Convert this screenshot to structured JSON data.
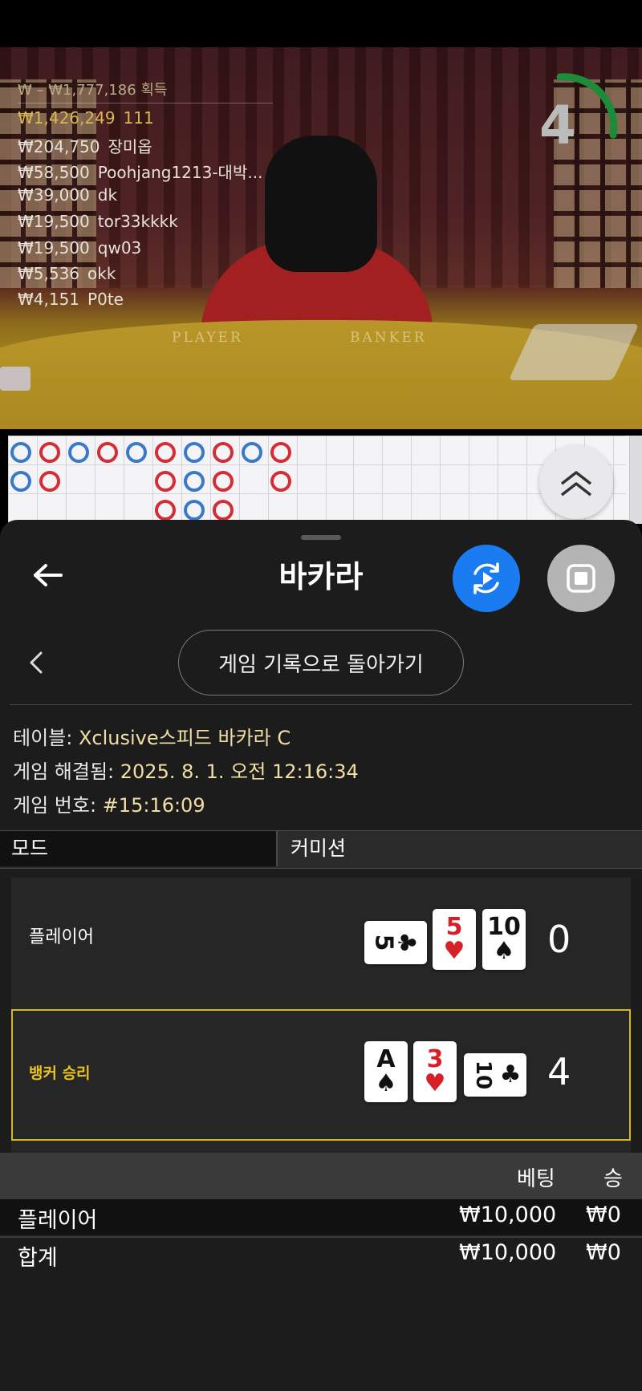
{
  "leaderboard": {
    "header": "₩ – ₩1,777,186 획득",
    "rows": [
      {
        "amount": "₩1,426,249",
        "name": "111"
      },
      {
        "amount": "₩204,750",
        "name": "장미옵"
      },
      {
        "amount": "₩58,500",
        "name": "Poohjang1213-대박..."
      },
      {
        "amount": "₩39,000",
        "name": "dk"
      },
      {
        "amount": "₩19,500",
        "name": "tor33kkkk"
      },
      {
        "amount": "₩19,500",
        "name": "qw03"
      },
      {
        "amount": "₩5,536",
        "name": "okk"
      },
      {
        "amount": "₩4,151",
        "name": "P0te"
      }
    ]
  },
  "video": {
    "table_labels": [
      "PLAYER",
      "BANKER"
    ],
    "timer": "4"
  },
  "sheet": {
    "title": "바카라",
    "history_button": "게임 기록으로 돌아가기",
    "info": {
      "table_label": "테이블:",
      "table_value": "Xclusive스피드 바카라 C",
      "resolved_label": "게임 해결됨:",
      "resolved_value": "2025. 8. 1. 오전 12:16:34",
      "number_label": "게임 번호:",
      "number_value": "#15:16:09"
    },
    "mode_label": "모드",
    "mode_value": "커미션"
  },
  "hands": {
    "player": {
      "label": "플레이어",
      "score": "0",
      "cards": [
        {
          "rank": "5",
          "suit": "♣",
          "color": "black",
          "orientation": "horizontal"
        },
        {
          "rank": "5",
          "suit": "♥",
          "color": "red",
          "orientation": "vertical"
        },
        {
          "rank": "10",
          "suit": "♠",
          "color": "black",
          "orientation": "vertical"
        }
      ]
    },
    "banker": {
      "label": "뱅커 승리",
      "score": "4",
      "cards": [
        {
          "rank": "A",
          "suit": "♠",
          "color": "black",
          "orientation": "vertical"
        },
        {
          "rank": "3",
          "suit": "♥",
          "color": "red",
          "orientation": "vertical"
        },
        {
          "rank": "10",
          "suit": "♣",
          "color": "black",
          "orientation": "horizontal"
        }
      ]
    }
  },
  "bets": {
    "columns": [
      "베팅",
      "승"
    ],
    "rows": [
      {
        "label": "플레이어",
        "bet": "₩10,000",
        "win": "₩0"
      }
    ],
    "total": {
      "label": "합계",
      "bet": "₩10,000",
      "win": "₩0"
    }
  },
  "colors": {
    "accent_blue": "#1a7cf0",
    "win_gold": "#d8b623",
    "banker_red": "#d42d35",
    "player_blue": "#3a78c9"
  }
}
